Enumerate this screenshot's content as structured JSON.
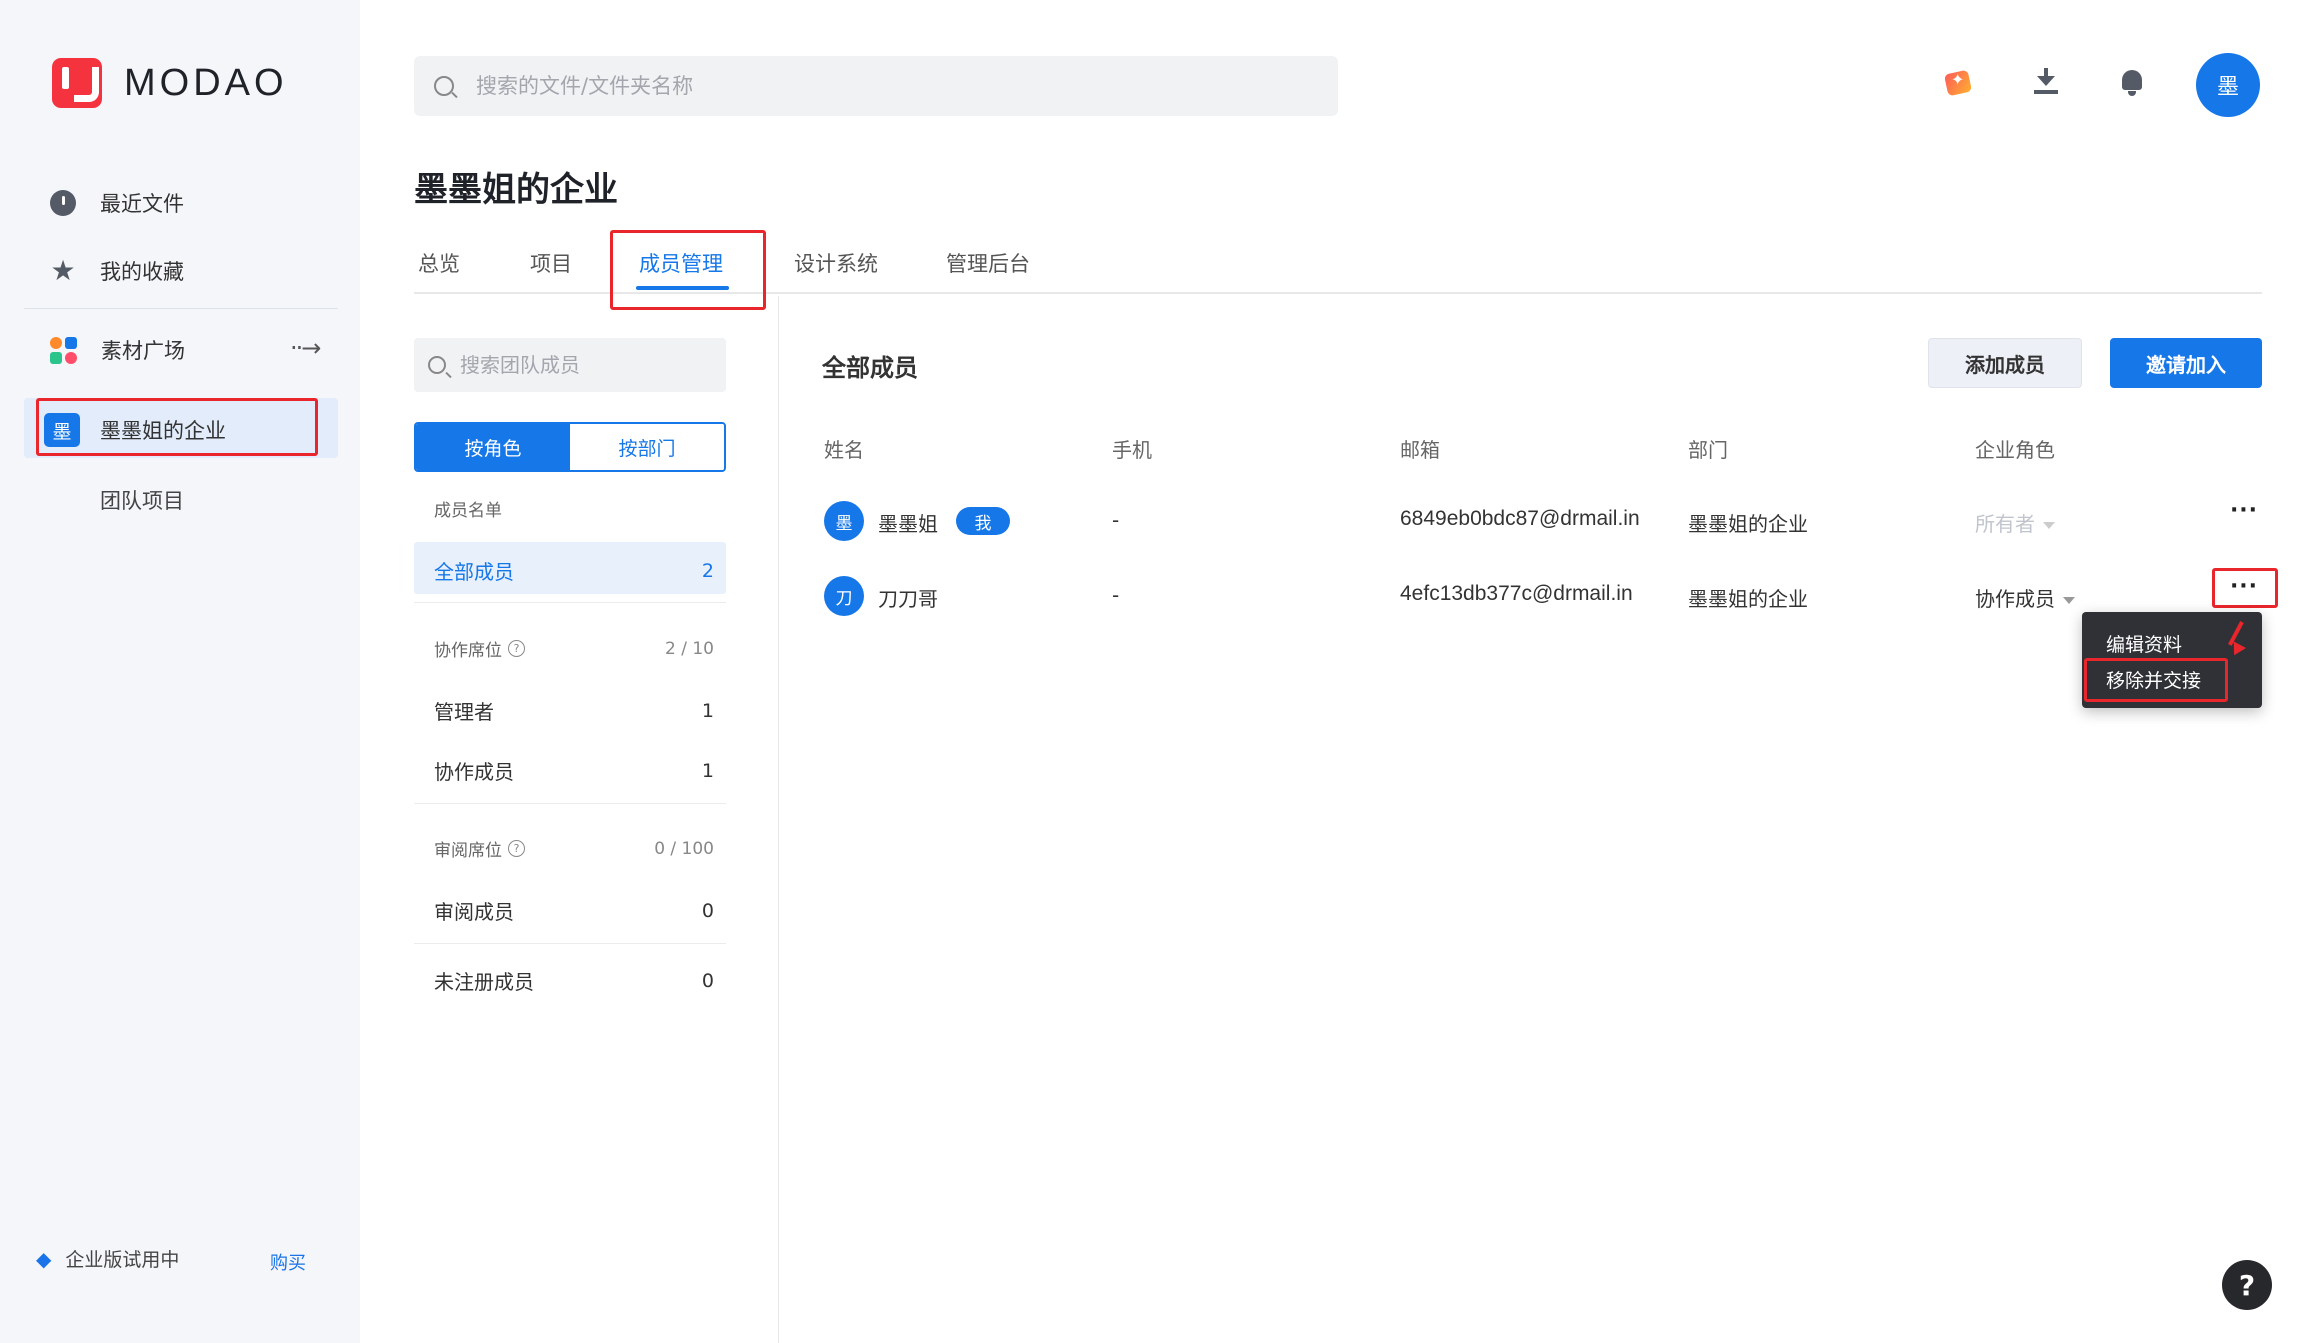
{
  "app": {
    "logo_text": "MODAO"
  },
  "sidebar": {
    "recent": "最近文件",
    "favorites": "我的收藏",
    "materials": "素材广场",
    "enterprise_badge": "墨",
    "enterprise": "墨墨姐的企业",
    "team_projects": "团队项目",
    "trial_text": "企业版试用中",
    "buy": "购买"
  },
  "header": {
    "search_placeholder": "搜索的文件/文件夹名称",
    "avatar_char": "墨"
  },
  "page": {
    "title": "墨墨姐的企业",
    "tabs": [
      "总览",
      "项目",
      "成员管理",
      "设计系统",
      "管理后台"
    ],
    "active_tab": "成员管理"
  },
  "left_panel": {
    "search_placeholder": "搜索团队成员",
    "segment": [
      "按角色",
      "按部门"
    ],
    "list_header": "成员名单",
    "all_members": {
      "label": "全部成员",
      "count": "2"
    },
    "collab_seats": {
      "label": "协作席位",
      "value": "2 / 10"
    },
    "admin": {
      "label": "管理者",
      "count": "1"
    },
    "collaborator": {
      "label": "协作成员",
      "count": "1"
    },
    "review_seats": {
      "label": "审阅席位",
      "value": "0 / 100"
    },
    "reviewer": {
      "label": "审阅成员",
      "count": "0"
    },
    "unregistered": {
      "label": "未注册成员",
      "count": "0"
    }
  },
  "members": {
    "title": "全部成员",
    "add_button": "添加成员",
    "invite_button": "邀请加入",
    "columns": [
      "姓名",
      "手机",
      "邮箱",
      "部门",
      "企业角色"
    ],
    "rows": [
      {
        "avatar": "墨",
        "name": "墨墨姐",
        "badge": "我",
        "phone": "-",
        "email": "6849eb0bdc87@drmail.in",
        "dept": "墨墨姐的企业",
        "role": "所有者"
      },
      {
        "avatar": "刀",
        "name": "刀刀哥",
        "phone": "-",
        "email": "4efc13db377c@drmail.in",
        "dept": "墨墨姐的企业",
        "role": "协作成员"
      }
    ],
    "more_glyph": "···"
  },
  "context_menu": {
    "edit_profile": "编辑资料",
    "remove_transfer": "移除并交接"
  },
  "help": "?",
  "colors": {
    "accent": "#1677e8",
    "highlight_box": "#e8262b"
  }
}
